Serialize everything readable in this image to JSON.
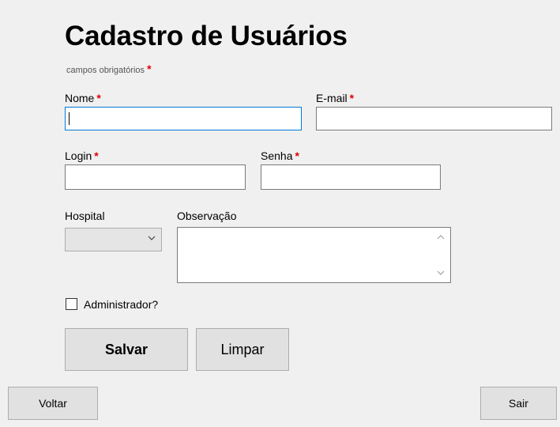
{
  "form": {
    "title": "Cadastro de Usuários",
    "required_note": "campos obrigatórios",
    "required_marker": "*"
  },
  "fields": {
    "nome": {
      "label": "Nome",
      "value": ""
    },
    "email": {
      "label": "E-mail",
      "value": ""
    },
    "login": {
      "label": "Login",
      "value": ""
    },
    "senha": {
      "label": "Senha",
      "value": ""
    },
    "hospital": {
      "label": "Hospital",
      "selected": ""
    },
    "observacao": {
      "label": "Observação",
      "value": ""
    }
  },
  "checkbox": {
    "label": "Administrador?",
    "checked": false
  },
  "buttons": {
    "save": "Salvar",
    "clear": "Limpar",
    "back": "Voltar",
    "exit": "Sair"
  },
  "icons": {
    "dropdown": "chevron-down-icon",
    "scroll_up": "chevron-up-icon",
    "scroll_down": "chevron-down-icon"
  },
  "colors": {
    "background": "#f0f0f0",
    "required": "#e00000",
    "focus_border": "#0078d7",
    "button": "#e1e1e1"
  }
}
